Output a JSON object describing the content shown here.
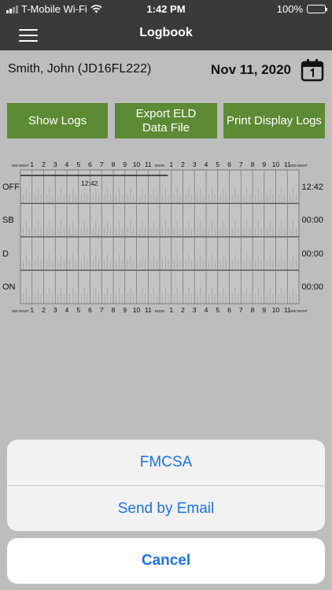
{
  "status_bar": {
    "carrier": "T-Mobile Wi-Fi",
    "time": "1:42 PM",
    "battery": "100%"
  },
  "nav": {
    "title": "Logbook"
  },
  "driver": {
    "name": "Smith, John (JD16FL222)",
    "date": "Nov 11, 2020"
  },
  "buttons": {
    "show_logs": "Show Logs",
    "export_line1": "Export ELD",
    "export_line2": "Data File",
    "print": "Print Display Logs"
  },
  "log_grid": {
    "hour_labels": [
      "MID NIGHT",
      "1",
      "2",
      "3",
      "4",
      "5",
      "6",
      "7",
      "8",
      "9",
      "10",
      "11",
      "NOON",
      "1",
      "2",
      "3",
      "4",
      "5",
      "6",
      "7",
      "8",
      "9",
      "10",
      "11",
      "MID NIGHT"
    ],
    "rows": [
      {
        "status": "OFF",
        "total": "12:42"
      },
      {
        "status": "SB",
        "total": "00:00"
      },
      {
        "status": "D",
        "total": "00:00"
      },
      {
        "status": "ON",
        "total": "00:00"
      }
    ],
    "segment": {
      "status": "OFF",
      "start_hour": 0,
      "end_hour": 12.7,
      "label": "12:42"
    },
    "colors": {
      "grid": "#7d7d7d",
      "line": "#222222"
    }
  },
  "action_sheet": {
    "options": [
      "FMCSA",
      "Send by Email"
    ],
    "cancel": "Cancel"
  },
  "colors": {
    "accent_green": "#5d8a34",
    "ios_blue": "#1a73e8",
    "header": "#3a3a3a",
    "background": "#bdbdbd"
  }
}
